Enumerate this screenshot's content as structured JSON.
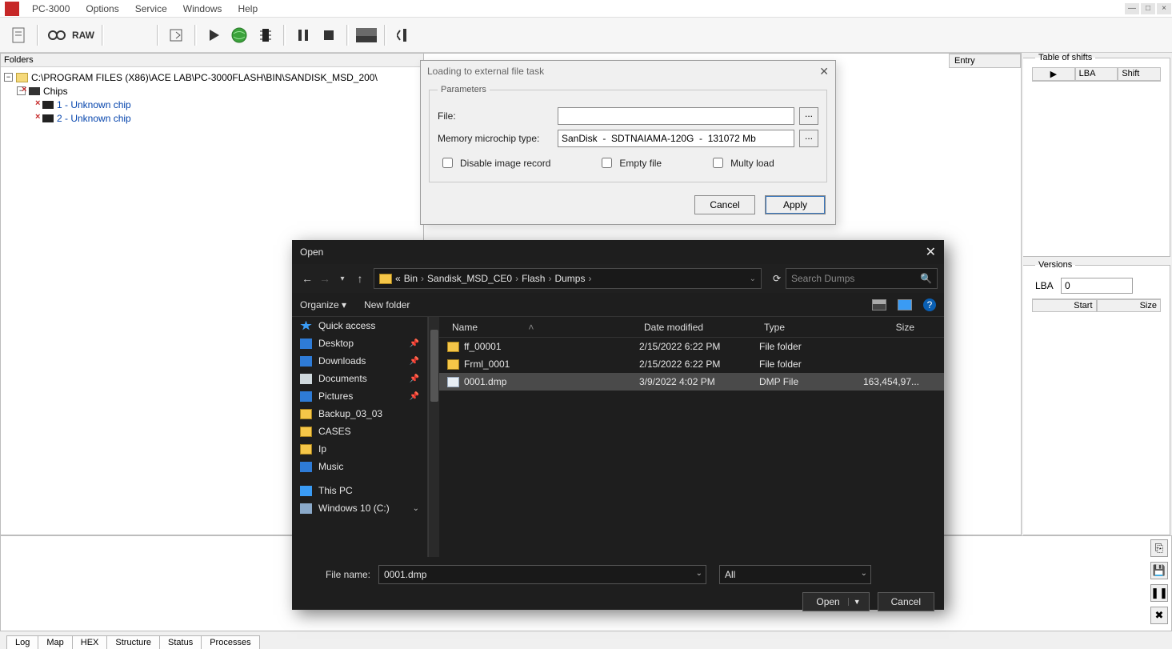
{
  "app": {
    "title": "PC-3000"
  },
  "menu": {
    "options": "Options",
    "service": "Service",
    "windows": "Windows",
    "help": "Help"
  },
  "toolbar": {
    "raw": "RAW"
  },
  "folders": {
    "title": "Folders",
    "root": "C:\\PROGRAM FILES (X86)\\ACE LAB\\PC-3000FLASH\\BIN\\SANDISK_MSD_200\\",
    "chips": "Chips",
    "chip1": "1 - Unknown chip",
    "chip2": "2 - Unknown chip"
  },
  "center": {
    "entry": "Entry"
  },
  "shifts": {
    "title": "Table of shifts",
    "col_lba": "LBA",
    "col_shift": "Shift"
  },
  "versions": {
    "title": "Versions",
    "lba_label": "LBA",
    "lba_value": "0",
    "col_start": "Start",
    "col_size": "Size"
  },
  "statusTabs": {
    "log": "Log",
    "map": "Map",
    "hex": "HEX",
    "structure": "Structure",
    "status": "Status",
    "processes": "Processes"
  },
  "dlgLoad": {
    "title": "Loading to external file task",
    "params_legend": "Parameters",
    "file_label": "File:",
    "file_value": "",
    "mem_label": "Memory microchip type:",
    "mem_value": "SanDisk  -  SDTNAIAMA-120G  -  131072 Mb",
    "browse": "...",
    "chk_disable": "Disable image record",
    "chk_empty": "Empty file",
    "chk_multy": "Multy load",
    "btn_cancel": "Cancel",
    "btn_apply": "Apply"
  },
  "dlgOpen": {
    "title": "Open",
    "crumbs": {
      "pre": "«",
      "c0": "Bin",
      "c1": "Sandisk_MSD_CE0",
      "c2": "Flash",
      "c3": "Dumps"
    },
    "search_placeholder": "Search Dumps",
    "organize": "Organize ▾",
    "new_folder": "New folder",
    "side": {
      "quick": "Quick access",
      "desktop": "Desktop",
      "downloads": "Downloads",
      "documents": "Documents",
      "pictures": "Pictures",
      "backup": "Backup_03_03",
      "cases": "CASES",
      "ip": "Ip",
      "music": "Music",
      "thispc": "This PC",
      "win10": "Windows 10 (C:)"
    },
    "cols": {
      "name": "Name",
      "date": "Date modified",
      "type": "Type",
      "size": "Size"
    },
    "rows": [
      {
        "name": "ff_00001",
        "date": "2/15/2022 6:22 PM",
        "type": "File folder",
        "size": "",
        "kind": "folder"
      },
      {
        "name": "Frml_0001",
        "date": "2/15/2022 6:22 PM",
        "type": "File folder",
        "size": "",
        "kind": "folder"
      },
      {
        "name": "0001.dmp",
        "date": "3/9/2022 4:02 PM",
        "type": "DMP File",
        "size": "163,454,97...",
        "kind": "file",
        "selected": true
      }
    ],
    "fn_label": "File name:",
    "fn_value": "0001.dmp",
    "filter": "All",
    "btn_open": "Open",
    "btn_cancel": "Cancel"
  }
}
